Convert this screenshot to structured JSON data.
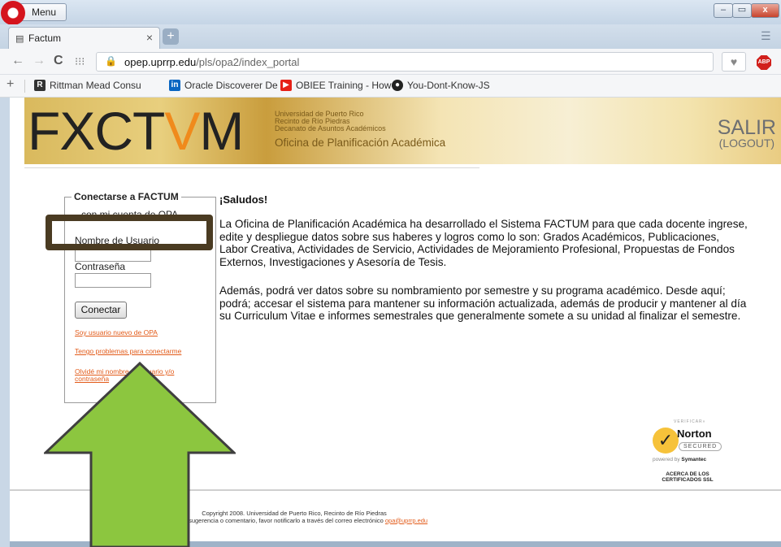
{
  "browser": {
    "menu_label": "Menu",
    "tab_title": "Factum",
    "tab_close": "×",
    "new_tab": "+",
    "url_host": "opep.uprrp.edu",
    "url_path": "/pls/opa2/index_portal",
    "abp_label": "ABP",
    "window_buttons": {
      "minimize": "–",
      "maximize": "▭",
      "close": "x"
    }
  },
  "bookmarks": [
    {
      "label": "Rittman Mead Consu",
      "icon": "rittman-icon",
      "color": "#333333"
    },
    {
      "label": "Oracle Discoverer De",
      "icon": "linkedin-icon",
      "color": "#0a66c2"
    },
    {
      "label": "OBIEE Training - How",
      "icon": "youtube-icon",
      "color": "#e62117"
    },
    {
      "label": "You-Dont-Know-JS",
      "icon": "github-icon",
      "color": "#222222"
    }
  ],
  "banner": {
    "logo_pre": "F",
    "logo_mid": "X",
    "logo_post": "CT",
    "logo_v": "V",
    "logo_end": "M",
    "line1": "Universidad de Puerto Rico",
    "line2": "Recinto de Río Piedras",
    "line3": "Decanato de Asuntos Académicos",
    "office": "Oficina de Planificación Académica",
    "salir": "SALIR",
    "logout": "(LOGOUT)"
  },
  "login": {
    "legend": "Conectarse a FACTUM",
    "subtitle": "con mi cuenta de OPA",
    "username_label": "Nombre de Usuario",
    "username_value": "",
    "password_label": "Contraseña",
    "password_value": "",
    "connect_button": "Conectar",
    "link_new_user": "Soy usuario nuevo de OPA",
    "link_profile": "Tengo problemas para conectarme",
    "link_forgot": "Olvidé mi nombre de usuario y/o contraseña"
  },
  "main": {
    "greeting": "¡Saludos!",
    "paragraph1": "La Oficina de Planificación Académica ha desarrollado el Sistema FACTUM para que cada docente ingrese, edite y despliegue datos sobre sus haberes y logros como lo son: Grados Académicos, Publicaciones, Labor Creativa, Actividades de Servicio, Actividades de Mejoramiento Profesional, Propuestas de Fondos Externos, Investigaciones y Asesoría de Tesis.",
    "paragraph2": "Además, podrá ver datos sobre su nombramiento por semestre y su programa académico. Desde aquí; podrá; accesar el sistema para mantener su información actualizada, además de producir y mantener al día su Curriculum Vitae e informes semestrales que generalmente somete a su unidad al finalizar el semestre."
  },
  "norton": {
    "verify": "VERIFICAR»",
    "name": "Norton",
    "secured": "SECURED",
    "powered_pre": "powered by ",
    "powered_brand": "Symantec",
    "about_line1": "ACERCA DE LOS",
    "about_line2": "CERTIFICADOS SSL"
  },
  "footer": {
    "copyright": "Copyright 2008. Universidad de Puerto Rico, Recinto de Río Piedras",
    "contact": "Cualquier sugerencia o comentario, favor notificarlo a través del correo electrónico ",
    "email": "opa@uprrp.edu"
  },
  "annotation": {
    "highlight_color": "#4a3b22",
    "arrow_color": "#8cc63f"
  }
}
